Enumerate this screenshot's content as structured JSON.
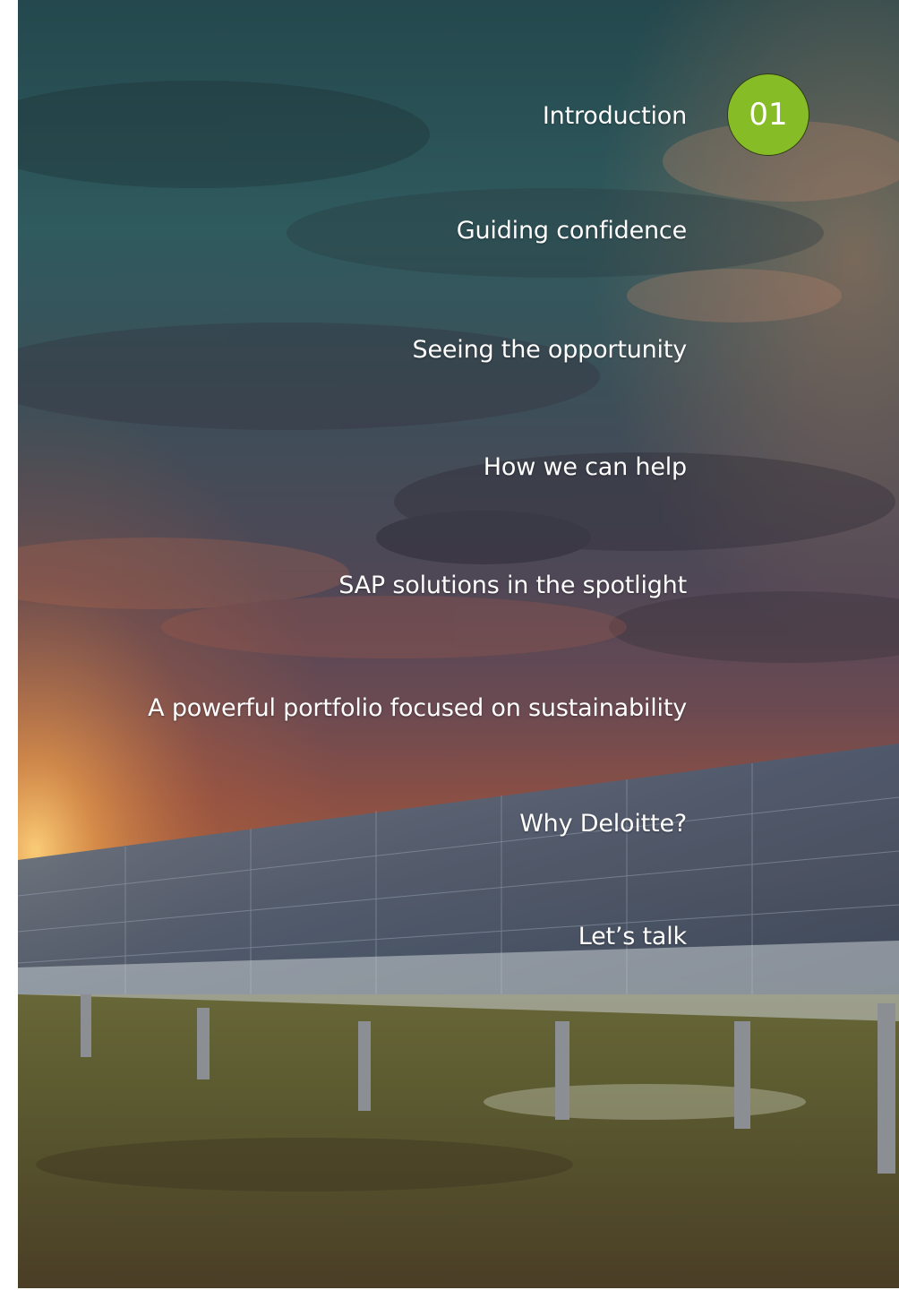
{
  "toc": {
    "items": [
      {
        "label": "Introduction"
      },
      {
        "label": "Guiding confidence"
      },
      {
        "label": "Seeing the opportunity"
      },
      {
        "label": "How we can help"
      },
      {
        "label": "SAP solutions in the spotlight"
      },
      {
        "label": "A powerful portfolio focused on sustainability"
      },
      {
        "label": "Why Deloitte?"
      },
      {
        "label": "Let’s talk"
      }
    ],
    "active_badge": "01"
  },
  "colors": {
    "accent": "#86bc25",
    "text": "#ffffff",
    "sky_top": "#2f4f55",
    "sunset": "#c0643a"
  }
}
